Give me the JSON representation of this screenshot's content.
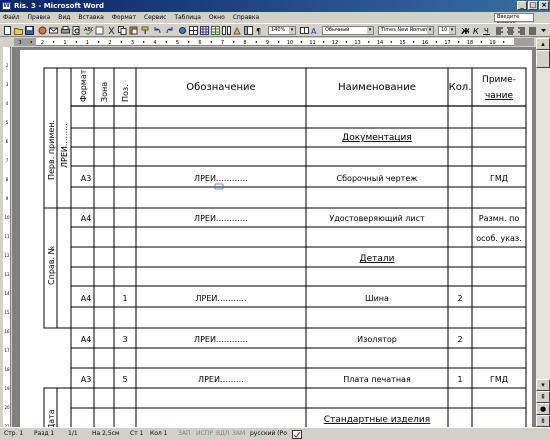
{
  "window": {
    "title": "Ris. 3 - Microsoft Word",
    "app_icon": "W"
  },
  "menu": {
    "items": [
      "Файл",
      "Правка",
      "Вид",
      "Вставка",
      "Формат",
      "Сервис",
      "Таблица",
      "Окно",
      "Справка"
    ],
    "help_placeholder": "Введите вопрос"
  },
  "toolbar": {
    "zoom": "140%",
    "style": "Обычный",
    "font": "Times New Roman",
    "size": "10"
  },
  "ruler": {
    "h_marks": [
      "3",
      "2",
      "1",
      "1",
      "2",
      "3",
      "4",
      "5",
      "6",
      "7",
      "8",
      "9",
      "10",
      "11",
      "12",
      "13",
      "14",
      "15",
      "16",
      "17",
      "18",
      "19"
    ],
    "v_marks": [
      "2",
      "3",
      "4",
      "5",
      "6",
      "7",
      "8",
      "9",
      "10",
      "11",
      "12",
      "13",
      "14",
      "15",
      "16",
      "17",
      "18",
      "19",
      "20",
      "21"
    ]
  },
  "table": {
    "headers": {
      "format": "Формат",
      "zone": "Зона",
      "pos": "Поз.",
      "designation": "Обозначение",
      "name": "Наименование",
      "qty": "Кол.",
      "note_line1": "Приме-",
      "note_line2": "чание"
    },
    "side_labels": {
      "first_use": "Перв. примен.",
      "first_use_code": "ЛРЕИ.........",
      "ref_no": "Справ. №",
      "date": "Дата"
    },
    "rows": {
      "documentation": "Документация",
      "assembly_format": "А3",
      "assembly_designation": "ЛРЕИ…………",
      "assembly_name": "Сборочный чертеж",
      "assembly_note": "ГМД",
      "cert_format": "А4",
      "cert_designation": "ЛРЕИ…………",
      "cert_name": "Удостоверяющий лист",
      "cert_note_1": "Размн. по",
      "cert_note_2": "особ. указ.",
      "parts": "Детали",
      "bus_format": "А4",
      "bus_pos": "1",
      "bus_designation": "ЛРЕИ………..",
      "bus_name": "Шина",
      "bus_qty": "2",
      "insul_format": "А4",
      "insul_pos": "3",
      "insul_designation": "ЛРЕИ…………",
      "insul_name": "Изолятор",
      "insul_qty": "2",
      "board_format": "А3",
      "board_pos": "5",
      "board_designation": "ЛРЕИ………",
      "board_name": "Плата печатная",
      "board_qty": "1",
      "board_note": "ГМД",
      "standard": "Стандартные изделия"
    }
  },
  "status": {
    "page": "Стр. 1",
    "section": "Разд 1",
    "pages": "1/1",
    "position": "На 2,5см",
    "line": "Ст 1",
    "col": "Кол 1",
    "rec": "ЗАП",
    "trk": "ИСПР",
    "ext": "ВДЛ",
    "ovr": "ЗАМ",
    "lang": "русский (Ро",
    "colors": {
      "title_left": "#0a246a",
      "title_right": "#3a6ea5",
      "chrome": "#d4d0c8",
      "desk": "#808080"
    }
  }
}
